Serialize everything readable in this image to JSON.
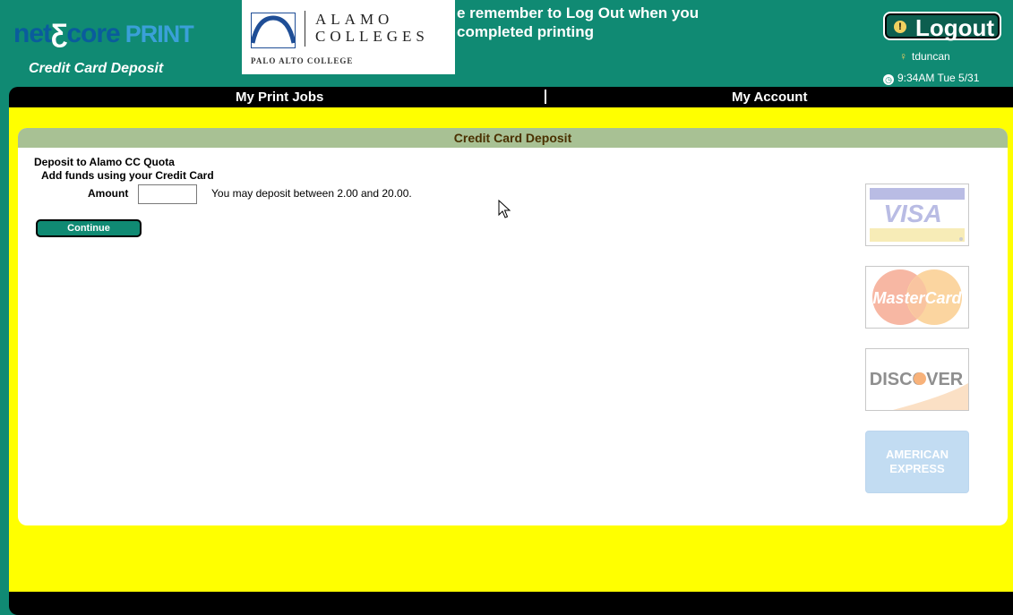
{
  "header": {
    "brand": {
      "part1": "net",
      "part2": "core",
      "print": "PRINT"
    },
    "subtitle": "Credit Card Deposit",
    "college": {
      "line1": "ALAMO",
      "line2": "COLLEGES",
      "sub": "PALO ALTO COLLEGE"
    },
    "notice_line1": "e remember to Log Out when you",
    "notice_line2": "completed printing",
    "logout_label": "Logout",
    "username": "tduncan",
    "time": "9:34AM Tue 5/31"
  },
  "nav": {
    "my_print_jobs": "My Print Jobs",
    "my_account": "My Account"
  },
  "deposit": {
    "header": "Credit Card Deposit",
    "title": "Deposit to Alamo CC Quota",
    "add_funds": "Add funds using your Credit Card",
    "amount_label": "Amount",
    "amount_value": "",
    "hint": "You may deposit between 2.00 and 20.00.",
    "continue_label": "Continue"
  },
  "cards": {
    "visa": "VISA",
    "mastercard": "MasterCard",
    "discover": "DISCOVER",
    "amex_line1": "AMERICAN",
    "amex_line2": "EXPRESS"
  },
  "colors": {
    "teal": "#108a73",
    "yellow": "#ffff00",
    "header_band": "#a8c194"
  }
}
